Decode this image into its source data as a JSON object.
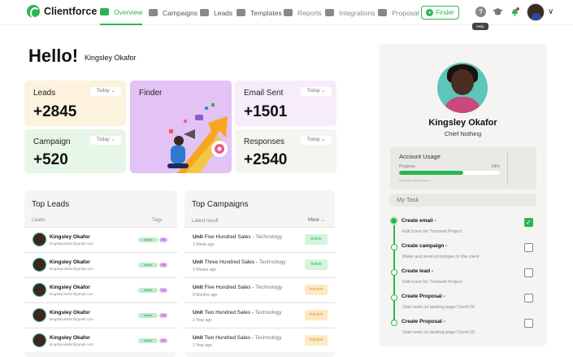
{
  "app": {
    "name": "Clientforce"
  },
  "nav": {
    "overview": "Overview",
    "campaigns": "Campaigns",
    "leads": "Leads",
    "templates": "Templates",
    "reports": "Reports",
    "integrations": "Integrations",
    "proposal": "Proposal",
    "finder": "Finder",
    "help_tooltip": "Help"
  },
  "greeting": {
    "hello": "Hello!",
    "name": "Kingsley Okafor"
  },
  "cards": {
    "leads": {
      "title": "Leads",
      "value": "+2845",
      "period": "Today ⌄"
    },
    "campaign": {
      "title": "Campaign",
      "value": "+520",
      "period": "Today ⌄"
    },
    "finder": {
      "title": "Finder"
    },
    "email_sent": {
      "title": "Email Sent",
      "value": "+1501",
      "period": "Today ⌄"
    },
    "responses": {
      "title": "Responses",
      "value": "+2540",
      "period": "Today ⌄"
    }
  },
  "top_leads": {
    "title": "Top Leads",
    "col_leads": "Leads",
    "col_tags": "Tags",
    "rows": [
      {
        "name": "Kingsley Okafor",
        "email": "kingsleyokafor@gmail.com",
        "tag1": "Unsub",
        "tag2": "DM"
      },
      {
        "name": "Kingsley Okafor",
        "email": "kingsleyokafor@gmail.com",
        "tag1": "Unsub",
        "tag2": "DM"
      },
      {
        "name": "Kingsley Okafor",
        "email": "kingsleyokafor@gmail.com",
        "tag1": "Unsub",
        "tag2": "DM"
      },
      {
        "name": "Kingsley Okafor",
        "email": "kingsleyokafor@gmail.com",
        "tag1": "Unsub",
        "tag2": "DM"
      },
      {
        "name": "Kingsley Okafor",
        "email": "kingsleyokafor@gmail.com",
        "tag1": "Unsub",
        "tag2": "DM"
      }
    ]
  },
  "top_campaigns": {
    "title": "Top Campaigns",
    "subtitle": "Latest result",
    "more": "More →",
    "rows": [
      {
        "unit": "Unit",
        "name": "Five Hundred Sales -",
        "cat": "Technology",
        "date": "1 Week ago",
        "status": "Active"
      },
      {
        "unit": "Unit",
        "name": "Three Hundred Sales -",
        "cat": "Technology",
        "date": "2 Weeks ago",
        "status": "Active"
      },
      {
        "unit": "Unit",
        "name": "Five Hundred Sales -",
        "cat": "Technology",
        "date": "8 Months ago",
        "status": "Inactive"
      },
      {
        "unit": "Unit",
        "name": "Two Hundred Sales -",
        "cat": "Technology",
        "date": "1 Year ago",
        "status": "Inactive"
      },
      {
        "unit": "Unit",
        "name": "Two Hundred Sales -",
        "cat": "Technology",
        "date": "1 Year ago",
        "status": "Inactive"
      }
    ]
  },
  "profile": {
    "name": "Kingsley Okafor",
    "role": "Chief Nothing",
    "usage_title": "Account Usage",
    "progress_label": "Progress",
    "progress_text": "64%",
    "progress": 0.64,
    "usage_note": "Not all plans have limitations",
    "mytask": "My Task",
    "tasks": [
      {
        "title": "Create email -",
        "desc": "Edit Icons for Tronweb Project",
        "done": true
      },
      {
        "title": "Create campaign -",
        "desc": "Make and send prototypes to the client",
        "done": false
      },
      {
        "title": "Create lead -",
        "desc": "Edit Icons for Tronweb Project",
        "done": false
      },
      {
        "title": "Create Proposal -",
        "desc": "Start work on landing page Covid-20",
        "done": false
      },
      {
        "title": "Create Proposal -",
        "desc": "Start work on landing page Covid-20",
        "done": false
      }
    ]
  },
  "colors": {
    "accent": "#2bb552",
    "leads_card": "#fdf2dd",
    "campaign_card": "#e6f7e8",
    "finder_card": "#e3c2f5",
    "email_card": "#f6ecfa",
    "responses_card": "#f4f4f0"
  }
}
